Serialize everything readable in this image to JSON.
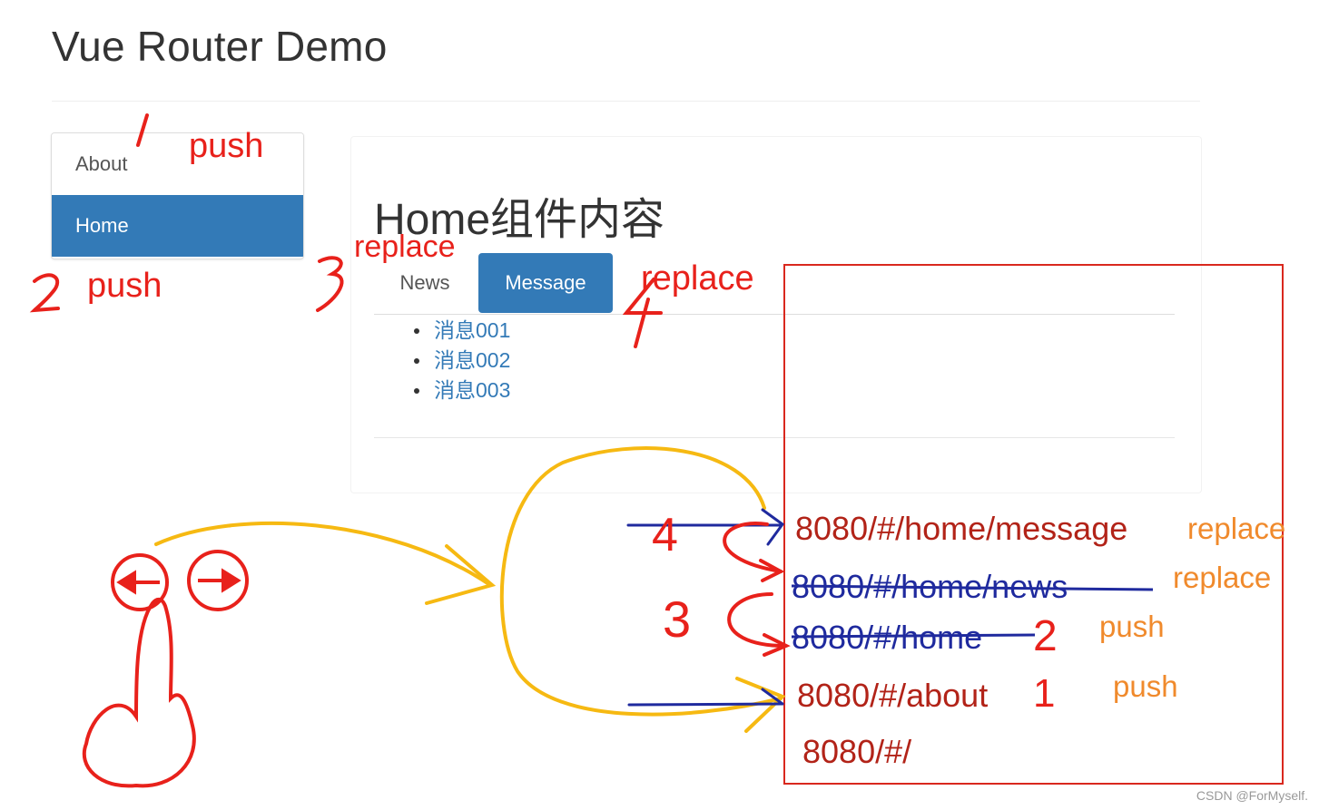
{
  "app": {
    "title": "Vue Router Demo"
  },
  "nav": {
    "items": [
      {
        "label": "About"
      },
      {
        "label": "Home"
      }
    ]
  },
  "home": {
    "heading": "Home组件内容",
    "tabs": [
      {
        "label": "News"
      },
      {
        "label": "Message"
      }
    ],
    "messages": [
      "消息001",
      "消息002",
      "消息003"
    ]
  },
  "annotations": {
    "push_about": "push",
    "num_1": "1",
    "push_home": "push",
    "num_2": "2",
    "replace_news": "replace",
    "num_3": "3",
    "replace_message": "replace",
    "num_4": "4",
    "stack_num_4": "4",
    "stack_num_3": "3",
    "stack_num_2": "2",
    "stack_num_1": "1"
  },
  "history_stack": [
    {
      "url": "8080/#/home/message",
      "method": "replace",
      "struck": false
    },
    {
      "url": "8080/#/home/news",
      "method": "replace",
      "struck": true
    },
    {
      "url": "8080/#/home",
      "method": "push",
      "struck": true
    },
    {
      "url": "8080/#/about",
      "method": "push",
      "struck": false
    },
    {
      "url": "8080/#/",
      "method": "",
      "struck": false
    }
  ],
  "footer": {
    "credit": "CSDN @ForMyself."
  },
  "colors": {
    "primary": "#337ab7",
    "annotation_red": "#e8211b",
    "annotation_orange": "#f08a2c",
    "arrow_yellow": "#f6b912",
    "strike_blue": "#1f2a9e"
  },
  "icons": [
    "back-arrow-icon",
    "forward-arrow-icon",
    "pointing-hand-icon"
  ]
}
